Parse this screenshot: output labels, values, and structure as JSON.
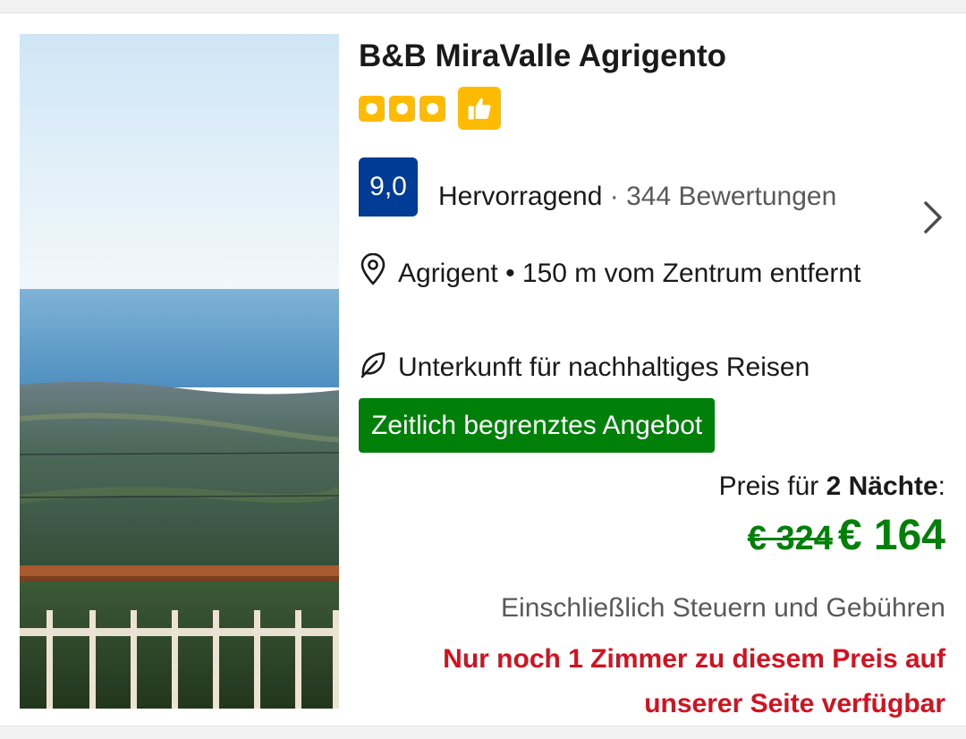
{
  "hotel": {
    "name": "B&B MiraValle Agrigento",
    "star_count": 3,
    "preferred_icon": "thumbs-up-icon",
    "photo_alt": "Balcony view"
  },
  "review": {
    "score": "9,0",
    "word": "Hervorragend",
    "separator": " · ",
    "count": "344 Bewertungen"
  },
  "location": {
    "icon": "map-pin-icon",
    "text": "Agrigent • 150 m vom Zentrum entfernt"
  },
  "sustainability": {
    "icon": "leaf-icon",
    "text": "Unterkunft für nachhaltiges Reisen"
  },
  "deal_badge": "Zeitlich begrenztes Angebot",
  "pricing": {
    "label_prefix": "Preis für ",
    "nights": "2 Nächte",
    "label_suffix": ":",
    "old_price": "€ 324",
    "new_price": "€ 164",
    "taxes_note": "Einschließlich Steuern und Gebühren",
    "scarcity": "Nur noch 1 Zimmer zu diesem Preis auf unserer Seite verfügbar"
  },
  "colors": {
    "brand_blue": "#003b95",
    "star_yellow": "#febb02",
    "deal_green": "#008009",
    "urgent_red": "#d4111e"
  }
}
